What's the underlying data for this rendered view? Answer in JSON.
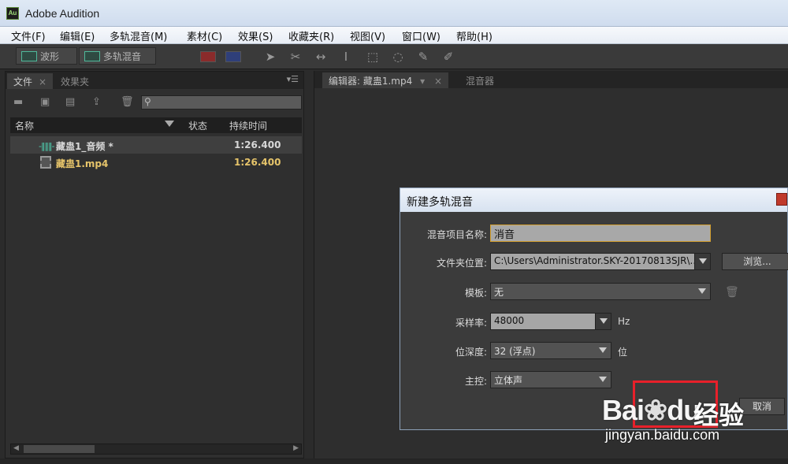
{
  "window": {
    "app_icon": "Au",
    "title": "Adobe Audition"
  },
  "menu": [
    "文件(F)",
    "编辑(E)",
    "多轨混音(M)",
    "素材(C)",
    "效果(S)",
    "收藏夹(R)",
    "视图(V)",
    "窗口(W)",
    "帮助(H)"
  ],
  "toolbar": {
    "waveform": "波形",
    "multitrack": "多轨混音"
  },
  "files_panel": {
    "tabs": [
      "文件",
      "效果夹"
    ],
    "columns": [
      "名称",
      "状态",
      "持续时间"
    ],
    "rows": [
      {
        "name": "藏蛊1_音频 *",
        "duration": "1:26.400",
        "color": "#d8d8d8",
        "type": "audio"
      },
      {
        "name": "藏蛊1.mp4",
        "duration": "1:26.400",
        "color": "#e6c46a",
        "type": "video"
      }
    ]
  },
  "editor_panel": {
    "tabs": [
      "编辑器: 藏蛊1.mp4",
      "混音器"
    ]
  },
  "dialog": {
    "title": "新建多轨混音",
    "fields": {
      "name_label": "混音项目名称:",
      "name_value": "消音",
      "folder_label": "文件夹位置:",
      "folder_value": "C:\\Users\\Administrator.SKY-20170813SJR\\...",
      "browse": "浏览...",
      "template_label": "模板:",
      "template_value": "无",
      "samplerate_label": "采样率:",
      "samplerate_value": "48000",
      "samplerate_unit": "Hz",
      "bitdepth_label": "位深度:",
      "bitdepth_value": "32 (浮点)",
      "bitdepth_unit": "位",
      "master_label": "主控:",
      "master_value": "立体声"
    },
    "cancel": "取消"
  },
  "watermark": {
    "logo": "Bai",
    "logo2": "du",
    "jingyan": "经验",
    "url": "jingyan.baidu.com"
  },
  "colors": {
    "accent_teal": "#4fd0b0",
    "highlight_red": "#e8202a",
    "input_border": "#d4a030"
  }
}
